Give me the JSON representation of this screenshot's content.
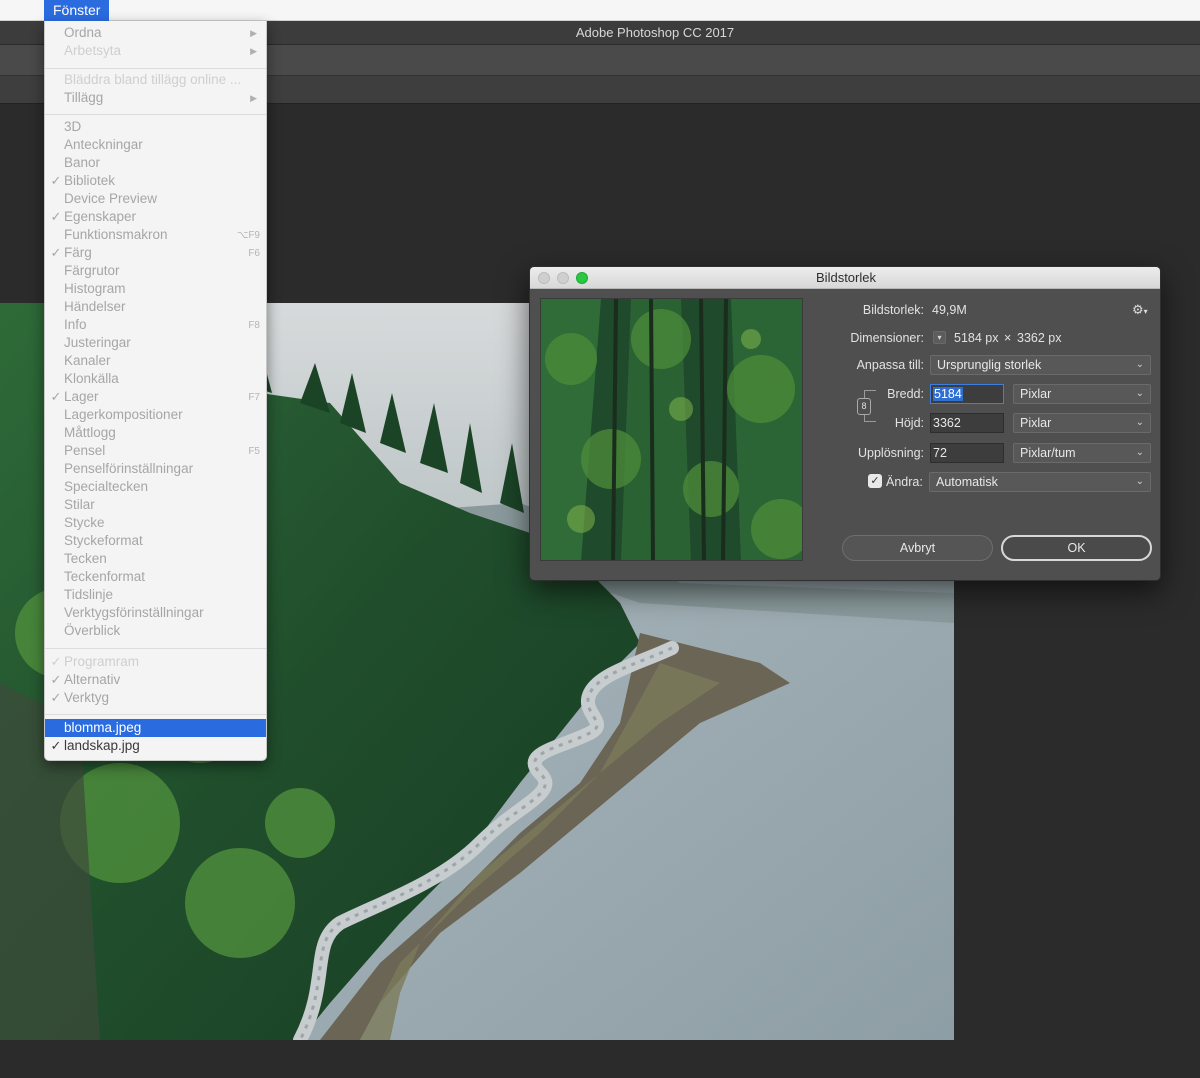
{
  "menubar": {
    "active_menu": "Fönster"
  },
  "app": {
    "title": "Adobe Photoshop CC 2017"
  },
  "menu": {
    "items": [
      {
        "label": "Ordna",
        "submenu": true,
        "state": "normal"
      },
      {
        "label": "Arbetsyta",
        "submenu": true,
        "state": "disabled"
      },
      {
        "label": "Bläddra bland tillägg online ...",
        "state": "disabled"
      },
      {
        "label": "Tillägg",
        "submenu": true,
        "state": "normal"
      },
      {
        "label": "3D",
        "state": "normal"
      },
      {
        "label": "Anteckningar",
        "state": "normal"
      },
      {
        "label": "Banor",
        "state": "normal"
      },
      {
        "label": "Bibliotek",
        "checked": true,
        "state": "normal"
      },
      {
        "label": "Device Preview",
        "state": "normal"
      },
      {
        "label": "Egenskaper",
        "checked": true,
        "state": "normal"
      },
      {
        "label": "Funktionsmakron",
        "shortcut": "⌥F9",
        "state": "normal"
      },
      {
        "label": "Färg",
        "checked": true,
        "shortcut": "F6",
        "state": "normal"
      },
      {
        "label": "Färgrutor",
        "state": "normal"
      },
      {
        "label": "Histogram",
        "state": "normal"
      },
      {
        "label": "Händelser",
        "state": "normal"
      },
      {
        "label": "Info",
        "shortcut": "F8",
        "state": "normal"
      },
      {
        "label": "Justeringar",
        "state": "normal"
      },
      {
        "label": "Kanaler",
        "state": "normal"
      },
      {
        "label": "Klonkälla",
        "state": "normal"
      },
      {
        "label": "Lager",
        "checked": true,
        "shortcut": "F7",
        "state": "normal"
      },
      {
        "label": "Lagerkompositioner",
        "state": "normal"
      },
      {
        "label": "Måttlogg",
        "state": "normal"
      },
      {
        "label": "Pensel",
        "shortcut": "F5",
        "state": "normal"
      },
      {
        "label": "Penselförinställningar",
        "state": "normal"
      },
      {
        "label": "Specialtecken",
        "state": "normal"
      },
      {
        "label": "Stilar",
        "state": "normal"
      },
      {
        "label": "Stycke",
        "state": "normal"
      },
      {
        "label": "Styckeformat",
        "state": "normal"
      },
      {
        "label": "Tecken",
        "state": "normal"
      },
      {
        "label": "Teckenformat",
        "state": "normal"
      },
      {
        "label": "Tidslinje",
        "state": "normal"
      },
      {
        "label": "Verktygsförinställningar",
        "state": "normal"
      },
      {
        "label": "Överblick",
        "state": "normal"
      },
      {
        "label": "Programram",
        "checked": true,
        "state": "disabled"
      },
      {
        "label": "Alternativ",
        "checked": true,
        "state": "normal"
      },
      {
        "label": "Verktyg",
        "checked": true,
        "state": "normal"
      },
      {
        "label": "blomma.jpeg",
        "state": "highlighted"
      },
      {
        "label": "landskap.jpg",
        "checked": true,
        "state": "active"
      }
    ]
  },
  "dialog": {
    "title": "Bildstorlek",
    "image_size_label": "Bildstorlek:",
    "image_size_value": "49,9M",
    "dimensions_label": "Dimensioner:",
    "dimensions_width": "5184 px",
    "dimensions_times": "×",
    "dimensions_height": "3362 px",
    "fit_label": "Anpassa till:",
    "fit_value": "Ursprunglig storlek",
    "width_label": "Bredd:",
    "width_value": "5184",
    "width_unit": "Pixlar",
    "height_label": "Höjd:",
    "height_value": "3362",
    "height_unit": "Pixlar",
    "resolution_label": "Upplösning:",
    "resolution_value": "72",
    "resolution_unit": "Pixlar/tum",
    "resample_label": "Ändra:",
    "resample_checked": true,
    "resample_value": "Automatisk",
    "cancel_label": "Avbryt",
    "ok_label": "OK"
  },
  "icons": {
    "gear": "gear-icon",
    "chain": "chain-link-icon",
    "chevron": "chevron-down-icon",
    "check": "checkmark-icon",
    "submenu_arrow": "triangle-right-icon"
  },
  "colors": {
    "menu_highlight": "#2a6ce0",
    "dialog_bg": "#4f4f4f",
    "traffic_green": "#28c840",
    "selection_blue": "#2f6fd1"
  }
}
